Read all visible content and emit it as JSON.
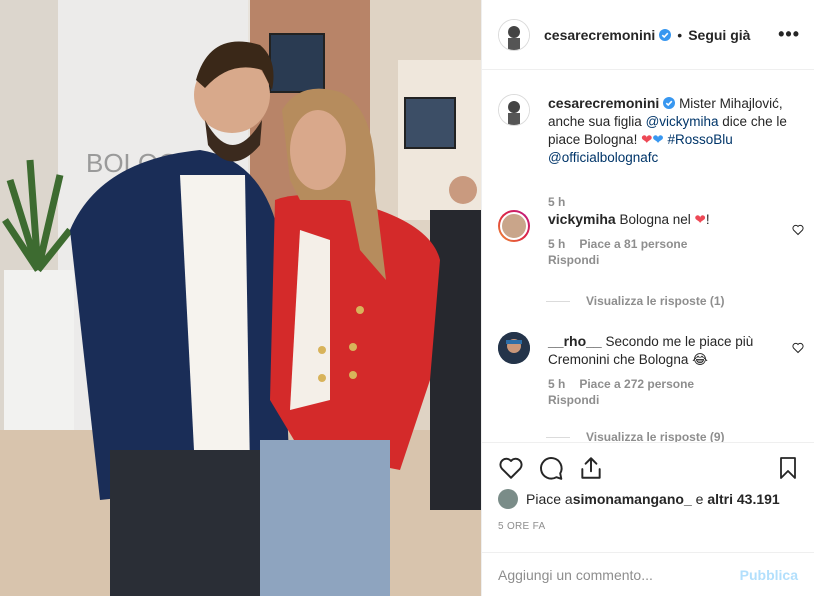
{
  "post": {
    "username": "cesarecremonini",
    "follow_status": "Segui già",
    "more_icon": "more-horizontal-icon"
  },
  "caption": {
    "username": "cesarecremonini",
    "text_1": "Mister Mihajlović, anche sua figlia ",
    "mention_1": "@vickymiha",
    "text_2": " dice che le piace Bologna! ",
    "hashtag": "#RossoBlu",
    "mention_2": "@officialbolognafc",
    "age": "5 h"
  },
  "comments": [
    {
      "username": "vickymiha",
      "text": "Bologna nel ",
      "text_end": "!",
      "age": "5 h",
      "likes": "Piace a 81 persone",
      "reply": "Rispondi",
      "view_replies": "Visualizza le risposte (1)"
    },
    {
      "username": "__rho__",
      "text": "Secondo me le piace più Cremonini che Bologna ",
      "age": "5 h",
      "likes": "Piace a 272 persone",
      "reply": "Rispondi",
      "view_replies": "Visualizza le risposte (9)"
    }
  ],
  "likes": {
    "prefix": "Piace a ",
    "user": "simonamangano_",
    "middle": " e ",
    "others": "altri 43.191"
  },
  "timestamp": "5 ORE FA",
  "add_comment": {
    "placeholder": "Aggiungi un commento...",
    "publish": "Pubblica"
  },
  "photo_sign": "BOLOGN",
  "colors": {
    "verified": "#3897f0",
    "red_heart": "#ed4956",
    "blue_heart": "#3897f0",
    "link": "#003569"
  }
}
